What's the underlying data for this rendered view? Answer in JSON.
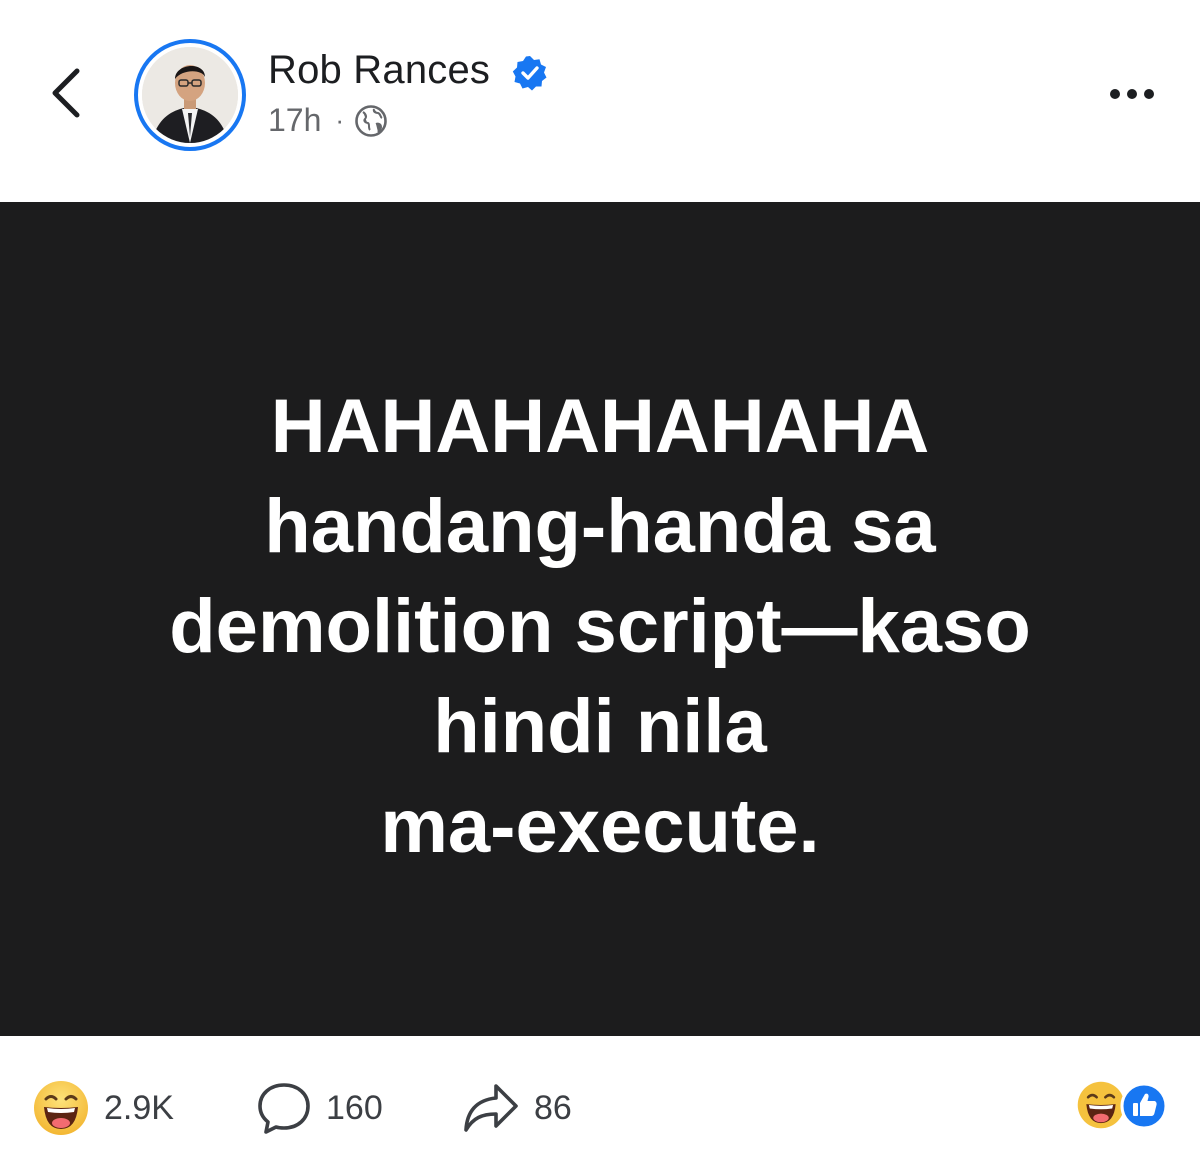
{
  "header": {
    "author_name": "Rob Rances",
    "timestamp": "17h",
    "separator": "·",
    "verified": true,
    "privacy_icon": "globe-icon"
  },
  "post": {
    "lines": [
      "HAHAHAHAHAHA",
      "handang-handa sa",
      "demolition script—kaso",
      "hindi nila",
      "ma-execute."
    ],
    "background_color": "#1c1c1d",
    "text_color": "#ffffff"
  },
  "footer": {
    "reaction_count": "2.9K",
    "comment_count": "160",
    "share_count": "86",
    "reaction_icons": [
      "haha-icon",
      "like-icon"
    ]
  },
  "colors": {
    "accent": "#1877f2",
    "haha_yellow": "#f7c94b",
    "secondary_text": "#65676b"
  }
}
